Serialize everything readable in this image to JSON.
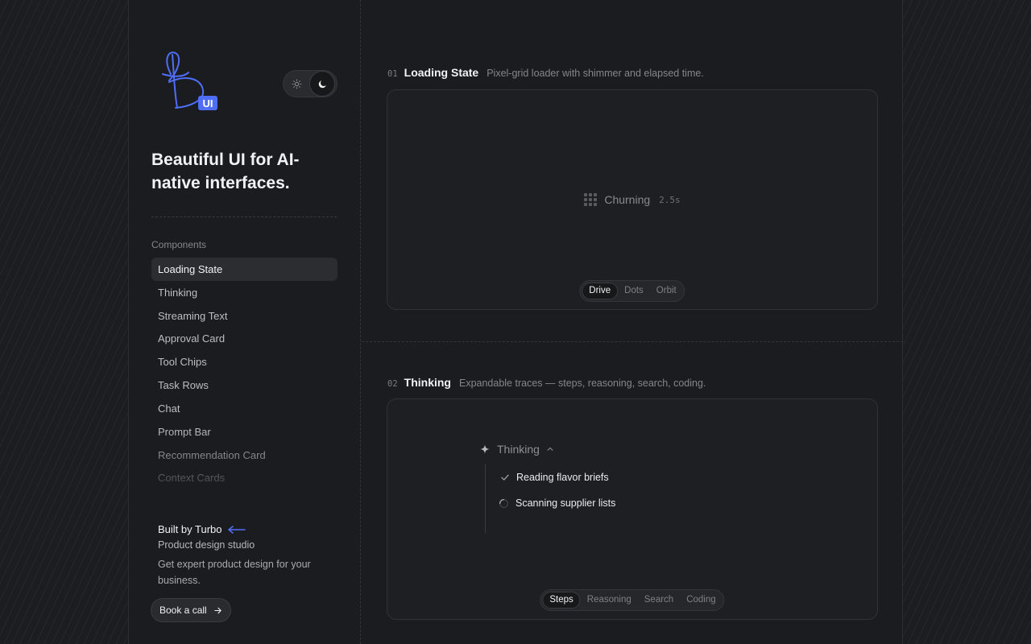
{
  "brand": {
    "logo_badge": "UI",
    "headline": "Beautiful UI for AI-native interfaces."
  },
  "theme_toggle": {
    "light_icon": "sun-icon",
    "dark_icon": "moon-icon",
    "selected": "dark"
  },
  "nav": {
    "label": "Components",
    "items": [
      {
        "label": "Loading State",
        "active": true
      },
      {
        "label": "Thinking"
      },
      {
        "label": "Streaming Text"
      },
      {
        "label": "Approval Card"
      },
      {
        "label": "Tool Chips"
      },
      {
        "label": "Task Rows"
      },
      {
        "label": "Chat"
      },
      {
        "label": "Prompt Bar"
      },
      {
        "label": "Recommendation Card"
      },
      {
        "label": "Context Cards"
      }
    ]
  },
  "footer": {
    "built_by": "Built by Turbo",
    "subtitle": "Product design studio",
    "description": "Get expert product design for your business.",
    "cta": "Book a call"
  },
  "sections": [
    {
      "number": "01",
      "title": "Loading State",
      "description": "Pixel-grid loader with shimmer and elapsed time.",
      "loader": {
        "label": "Churning",
        "elapsed": "2.5s"
      },
      "tabs": [
        "Drive",
        "Dots",
        "Orbit"
      ],
      "active_tab": "Drive"
    },
    {
      "number": "02",
      "title": "Thinking",
      "description": "Expandable traces — steps, reasoning, search, coding.",
      "thinking": {
        "label": "Thinking",
        "steps": [
          {
            "label": "Reading flavor briefs",
            "status": "done"
          },
          {
            "label": "Scanning supplier lists",
            "status": "in-progress"
          }
        ]
      },
      "tabs": [
        "Steps",
        "Reasoning",
        "Search",
        "Coding"
      ],
      "active_tab": "Steps"
    }
  ],
  "colors": {
    "accent": "#4f6ef7",
    "background": "#1c1d20",
    "card": "#1e1f22"
  }
}
